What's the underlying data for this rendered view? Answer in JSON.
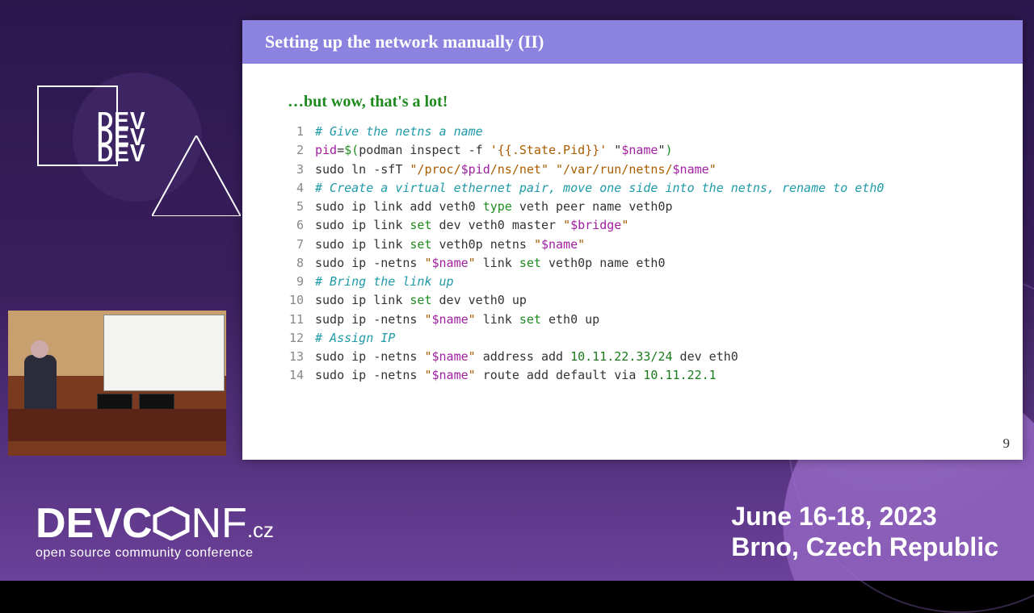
{
  "slide": {
    "title": "Setting up the network manually (II)",
    "subhead": "…but wow, that's a lot!",
    "page_number": "9",
    "code": [
      [
        {
          "t": "# Give the netns a name",
          "c": "comment"
        }
      ],
      [
        {
          "t": "pid",
          "c": "var"
        },
        {
          "t": "=",
          "c": "cmd"
        },
        {
          "t": "$(",
          "c": "kw"
        },
        {
          "t": "podman inspect -f ",
          "c": "cmd"
        },
        {
          "t": "'{{.State.Pid}}'",
          "c": "str"
        },
        {
          "t": " \"",
          "c": "cmd"
        },
        {
          "t": "$name",
          "c": "var"
        },
        {
          "t": "\"",
          "c": "cmd"
        },
        {
          "t": ")",
          "c": "kw"
        }
      ],
      [
        {
          "t": "sudo ln -sfT ",
          "c": "cmd"
        },
        {
          "t": "\"/proc/",
          "c": "str"
        },
        {
          "t": "$pid",
          "c": "var"
        },
        {
          "t": "/ns/net\"",
          "c": "str"
        },
        {
          "t": " ",
          "c": "cmd"
        },
        {
          "t": "\"/var/run/netns/",
          "c": "str"
        },
        {
          "t": "$name",
          "c": "var"
        },
        {
          "t": "\"",
          "c": "str"
        }
      ],
      [
        {
          "t": "# Create a virtual ethernet pair, move one side into the netns, rename to eth0",
          "c": "comment"
        }
      ],
      [
        {
          "t": "sudo ip link add veth0 ",
          "c": "cmd"
        },
        {
          "t": "type",
          "c": "kw"
        },
        {
          "t": " veth peer name veth0p",
          "c": "cmd"
        }
      ],
      [
        {
          "t": "sudo ip link ",
          "c": "cmd"
        },
        {
          "t": "set",
          "c": "kw"
        },
        {
          "t": " dev veth0 master ",
          "c": "cmd"
        },
        {
          "t": "\"",
          "c": "str"
        },
        {
          "t": "$bridge",
          "c": "var"
        },
        {
          "t": "\"",
          "c": "str"
        }
      ],
      [
        {
          "t": "sudo ip link ",
          "c": "cmd"
        },
        {
          "t": "set",
          "c": "kw"
        },
        {
          "t": " veth0p netns ",
          "c": "cmd"
        },
        {
          "t": "\"",
          "c": "str"
        },
        {
          "t": "$name",
          "c": "var"
        },
        {
          "t": "\"",
          "c": "str"
        }
      ],
      [
        {
          "t": "sudo ip -netns ",
          "c": "cmd"
        },
        {
          "t": "\"",
          "c": "str"
        },
        {
          "t": "$name",
          "c": "var"
        },
        {
          "t": "\"",
          "c": "str"
        },
        {
          "t": " link ",
          "c": "cmd"
        },
        {
          "t": "set",
          "c": "kw"
        },
        {
          "t": " veth0p name eth0",
          "c": "cmd"
        }
      ],
      [
        {
          "t": "# Bring the link up",
          "c": "comment"
        }
      ],
      [
        {
          "t": "sudo ip link ",
          "c": "cmd"
        },
        {
          "t": "set",
          "c": "kw"
        },
        {
          "t": " dev veth0 up",
          "c": "cmd"
        }
      ],
      [
        {
          "t": "sudp ip -netns ",
          "c": "cmd"
        },
        {
          "t": "\"",
          "c": "str"
        },
        {
          "t": "$name",
          "c": "var"
        },
        {
          "t": "\"",
          "c": "str"
        },
        {
          "t": " link ",
          "c": "cmd"
        },
        {
          "t": "set",
          "c": "kw"
        },
        {
          "t": " eth0 up",
          "c": "cmd"
        }
      ],
      [
        {
          "t": "# Assign IP",
          "c": "comment"
        }
      ],
      [
        {
          "t": "sudo ip -netns ",
          "c": "cmd"
        },
        {
          "t": "\"",
          "c": "str"
        },
        {
          "t": "$name",
          "c": "var"
        },
        {
          "t": "\"",
          "c": "str"
        },
        {
          "t": " address add ",
          "c": "cmd"
        },
        {
          "t": "10.11.22.33/24",
          "c": "num"
        },
        {
          "t": " dev eth0",
          "c": "cmd"
        }
      ],
      [
        {
          "t": "sudo ip -netns ",
          "c": "cmd"
        },
        {
          "t": "\"",
          "c": "str"
        },
        {
          "t": "$name",
          "c": "var"
        },
        {
          "t": "\"",
          "c": "str"
        },
        {
          "t": " route add default via ",
          "c": "cmd"
        },
        {
          "t": "10.11.22.1",
          "c": "num"
        }
      ]
    ]
  },
  "logo_text": "DEV",
  "footer": {
    "brand_bold": "DEVC",
    "brand_thin": "NF",
    "brand_suffix": ".cz",
    "tagline": "open source community conference",
    "date": "June 16-18, 2023",
    "location": "Brno, Czech Republic"
  }
}
